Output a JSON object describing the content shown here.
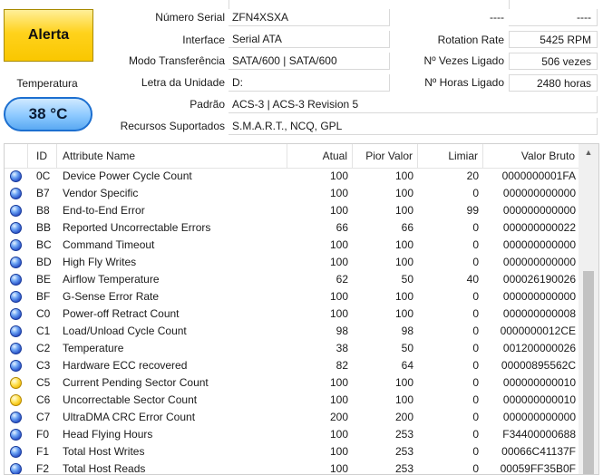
{
  "status": {
    "label": "Alerta",
    "temperature_label": "Temperatura",
    "temperature_value": "38 °C"
  },
  "info": {
    "serial_label": "Número Serial",
    "serial_value": "ZFN4XSXA",
    "interface_label": "Interface",
    "interface_value": "Serial ATA",
    "transfer_label": "Modo Transferência",
    "transfer_value": "SATA/600 | SATA/600",
    "drive_letter_label": "Letra da Unidade",
    "drive_letter_value": "D:",
    "standard_label": "Padrão",
    "standard_value": "ACS-3 | ACS-3 Revision 5",
    "features_label": "Recursos Suportados",
    "features_value": "S.M.A.R.T., NCQ, GPL",
    "right_top_label": "----",
    "right_top_value": "----",
    "rotation_label": "Rotation Rate",
    "rotation_value": "5425 RPM",
    "power_count_label": "Nº Vezes Ligado",
    "power_count_value": "506 vezes",
    "power_hours_label": "Nº Horas Ligado",
    "power_hours_value": "2480 horas"
  },
  "table": {
    "headers": {
      "id": "ID",
      "name": "Attribute Name",
      "current": "Atual",
      "worst": "Pior Valor",
      "threshold": "Limiar",
      "raw": "Valor Bruto"
    },
    "rows": [
      {
        "status": "blue",
        "id": "0C",
        "name": "Device Power Cycle Count",
        "current": "100",
        "worst": "100",
        "threshold": "20",
        "raw": "0000000001FA"
      },
      {
        "status": "blue",
        "id": "B7",
        "name": "Vendor Specific",
        "current": "100",
        "worst": "100",
        "threshold": "0",
        "raw": "000000000000"
      },
      {
        "status": "blue",
        "id": "B8",
        "name": "End-to-End Error",
        "current": "100",
        "worst": "100",
        "threshold": "99",
        "raw": "000000000000"
      },
      {
        "status": "blue",
        "id": "BB",
        "name": "Reported Uncorrectable Errors",
        "current": "66",
        "worst": "66",
        "threshold": "0",
        "raw": "000000000022"
      },
      {
        "status": "blue",
        "id": "BC",
        "name": "Command Timeout",
        "current": "100",
        "worst": "100",
        "threshold": "0",
        "raw": "000000000000"
      },
      {
        "status": "blue",
        "id": "BD",
        "name": "High Fly Writes",
        "current": "100",
        "worst": "100",
        "threshold": "0",
        "raw": "000000000000"
      },
      {
        "status": "blue",
        "id": "BE",
        "name": "Airflow Temperature",
        "current": "62",
        "worst": "50",
        "threshold": "40",
        "raw": "000026190026"
      },
      {
        "status": "blue",
        "id": "BF",
        "name": "G-Sense Error Rate",
        "current": "100",
        "worst": "100",
        "threshold": "0",
        "raw": "000000000000"
      },
      {
        "status": "blue",
        "id": "C0",
        "name": "Power-off Retract Count",
        "current": "100",
        "worst": "100",
        "threshold": "0",
        "raw": "000000000008"
      },
      {
        "status": "blue",
        "id": "C1",
        "name": "Load/Unload Cycle Count",
        "current": "98",
        "worst": "98",
        "threshold": "0",
        "raw": "0000000012CE"
      },
      {
        "status": "blue",
        "id": "C2",
        "name": "Temperature",
        "current": "38",
        "worst": "50",
        "threshold": "0",
        "raw": "001200000026"
      },
      {
        "status": "blue",
        "id": "C3",
        "name": "Hardware ECC recovered",
        "current": "82",
        "worst": "64",
        "threshold": "0",
        "raw": "00000895562C"
      },
      {
        "status": "yellow",
        "id": "C5",
        "name": "Current Pending Sector Count",
        "current": "100",
        "worst": "100",
        "threshold": "0",
        "raw": "000000000010"
      },
      {
        "status": "yellow",
        "id": "C6",
        "name": "Uncorrectable Sector Count",
        "current": "100",
        "worst": "100",
        "threshold": "0",
        "raw": "000000000010"
      },
      {
        "status": "blue",
        "id": "C7",
        "name": "UltraDMA CRC Error Count",
        "current": "200",
        "worst": "200",
        "threshold": "0",
        "raw": "000000000000"
      },
      {
        "status": "blue",
        "id": "F0",
        "name": "Head Flying Hours",
        "current": "100",
        "worst": "253",
        "threshold": "0",
        "raw": "F34400000688"
      },
      {
        "status": "blue",
        "id": "F1",
        "name": "Total Host Writes",
        "current": "100",
        "worst": "253",
        "threshold": "0",
        "raw": "00066C41137F"
      },
      {
        "status": "blue",
        "id": "F2",
        "name": "Total Host Reads",
        "current": "100",
        "worst": "253",
        "threshold": "0",
        "raw": "00059FF35B0F"
      }
    ]
  },
  "icons": {
    "scroll_up": "triangle-up"
  },
  "colors": {
    "alert_yellow": "#ffd21c",
    "temp_blue": "#8cc9ff",
    "status_blue": "#2a52c7",
    "status_yellow": "#f0b800"
  }
}
